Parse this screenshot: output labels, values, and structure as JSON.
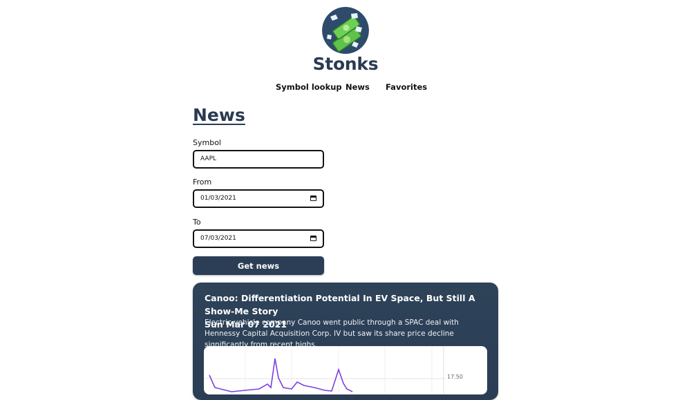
{
  "app": {
    "brand": "Stonks"
  },
  "nav": [
    "Symbol lookup",
    "News",
    "Favorites"
  ],
  "page": {
    "title": "News"
  },
  "form": {
    "symbol_label": "Symbol",
    "symbol_value": "AAPL",
    "from_label": "From",
    "from_value": "01/03/2021",
    "to_label": "To",
    "to_value": "07/03/2021",
    "submit_label": "Get news"
  },
  "article": {
    "title": "Canoo: Differentiation Potential In EV Space, But Still A Show-Me Story",
    "date": "Sun Mar 07 2021",
    "summary": "Electric vehicle company Canoo went public through a SPAC deal with Hennessy Capital Acquisition Corp. IV but saw its share price decline significantly from recent highs."
  },
  "chart": {
    "tick_label": "17.50",
    "line_color": "#7b3fe0"
  }
}
